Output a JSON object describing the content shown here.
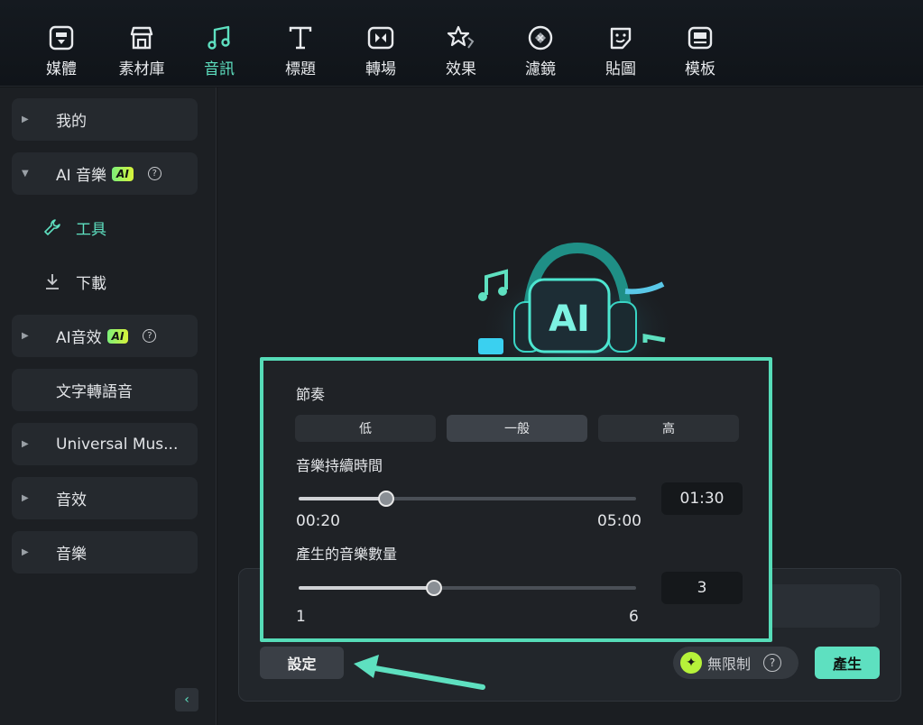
{
  "toolbar": {
    "items": [
      {
        "label": "媒體",
        "icon": "media-icon"
      },
      {
        "label": "素材庫",
        "icon": "store-icon"
      },
      {
        "label": "音訊",
        "icon": "music-note-icon",
        "active": true
      },
      {
        "label": "標題",
        "icon": "title-t-icon"
      },
      {
        "label": "轉場",
        "icon": "transition-icon"
      },
      {
        "label": "效果",
        "icon": "effects-star-icon"
      },
      {
        "label": "濾鏡",
        "icon": "filter-icon"
      },
      {
        "label": "貼圖",
        "icon": "sticker-icon"
      },
      {
        "label": "模板",
        "icon": "template-icon"
      }
    ]
  },
  "sidebar": {
    "items": [
      {
        "label": "我的",
        "caret": "▶"
      },
      {
        "label": "AI 音樂",
        "caret": "▼",
        "badge": "AI"
      },
      {
        "label": "工具",
        "icon": "wrench-icon"
      },
      {
        "label": "下載",
        "icon": "download-icon"
      },
      {
        "label": "AI音效",
        "caret": "▶",
        "badge": "AI"
      },
      {
        "label": "文字轉語音"
      },
      {
        "label": "Universal Mus...",
        "caret": "▶"
      },
      {
        "label": "音效",
        "caret": "▶"
      },
      {
        "label": "音樂",
        "caret": "▶"
      }
    ],
    "help_glyph": "?",
    "collapse_glyph": "‹"
  },
  "settings": {
    "tempo_label": "節奏",
    "tempo_options": [
      "低",
      "一般",
      "高"
    ],
    "tempo_selected": "一般",
    "duration_label": "音樂持續時間",
    "duration_value": "01:30",
    "duration_min": "00:20",
    "duration_max": "05:00",
    "duration_fraction": 0.26,
    "count_label": "產生的音樂數量",
    "count_value": "3",
    "count_min": "1",
    "count_max": "6",
    "count_fraction": 0.4
  },
  "footer": {
    "settings_button": "設定",
    "unlimited_label": "無限制",
    "help_glyph": "?",
    "generate_button": "產生"
  },
  "hero": {
    "ai_text": "AI"
  },
  "colors": {
    "accent": "#5ee0c0",
    "popup_border": "#56dcb8",
    "badge": "#b6f23a"
  }
}
